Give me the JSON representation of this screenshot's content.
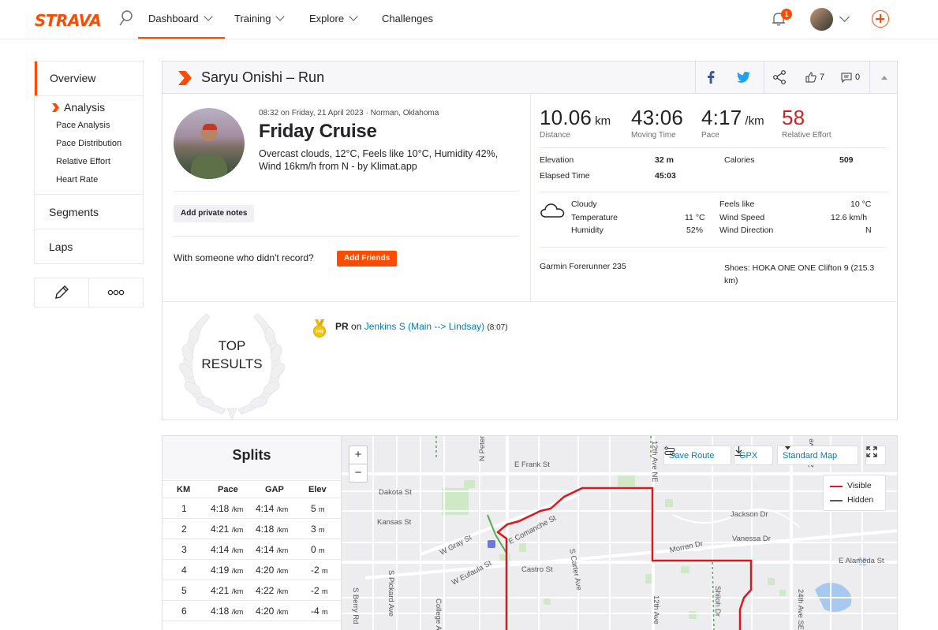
{
  "nav": {
    "logo": "STRAVA",
    "items": [
      {
        "label": "Dashboard"
      },
      {
        "label": "Training"
      },
      {
        "label": "Explore"
      },
      {
        "label": "Challenges"
      }
    ],
    "notif_count": "1",
    "accent": "#fc4c02"
  },
  "sidebar": {
    "overview": "Overview",
    "analysis": "Analysis",
    "subitems": [
      "Pace Analysis",
      "Pace Distribution",
      "Relative Effort",
      "Heart Rate"
    ],
    "segments": "Segments",
    "laps": "Laps"
  },
  "activity": {
    "header_title": "Saryu Onishi – Run",
    "kudos_count": "7",
    "comment_count": "0",
    "meta": "08:32 on Friday, 21 April 2023 · Norman, Oklahoma",
    "title": "Friday Cruise",
    "description": "Overcast clouds, 12°C, Feels like 10°C, Humidity 42%, Wind 16km/h from N - by Klimat.app",
    "add_notes": "Add private notes",
    "with_someone": "With someone who didn't record?",
    "add_friends": "Add Friends"
  },
  "stats": {
    "distance": {
      "value": "10.06",
      "unit": "km",
      "label": "Distance"
    },
    "moving_time": {
      "value": "43:06",
      "label": "Moving Time"
    },
    "pace": {
      "value": "4:17",
      "unit": "/km",
      "label": "Pace"
    },
    "relative_effort": {
      "value": "58",
      "label": "Relative Effort",
      "color": "#d81e1e"
    },
    "elevation_label": "Elevation",
    "elevation": "32 m",
    "calories_label": "Calories",
    "calories": "509",
    "elapsed_label": "Elapsed Time",
    "elapsed": "45:03"
  },
  "weather": {
    "condition": "Cloudy",
    "temperature_label": "Temperature",
    "temperature": "11 °C",
    "humidity_label": "Humidity",
    "humidity": "52%",
    "feels_label": "Feels like",
    "feels": "10 °C",
    "wind_speed_label": "Wind Speed",
    "wind_speed": "12.6 km/h",
    "wind_dir_label": "Wind Direction",
    "wind_dir": "N"
  },
  "gear": {
    "device": "Garmin Forerunner 235",
    "shoes": "Shoes: HOKA ONE ONE Clifton 9 (215.3 km)"
  },
  "results": {
    "top_results": "TOP RESULTS",
    "pr_label": "PR",
    "pr_on": "on",
    "segment": "Jenkins S (Main --> Lindsay)",
    "time": "(8:07)"
  },
  "splits": {
    "title": "Splits",
    "headers": [
      "KM",
      "Pace",
      "GAP",
      "Elev"
    ],
    "pace_unit": "/km",
    "elev_unit": "m",
    "rows": [
      {
        "km": "1",
        "pace": "4:18",
        "gap": "4:14",
        "elev": "5"
      },
      {
        "km": "2",
        "pace": "4:21",
        "gap": "4:18",
        "elev": "3"
      },
      {
        "km": "3",
        "pace": "4:14",
        "gap": "4:14",
        "elev": "0"
      },
      {
        "km": "4",
        "pace": "4:19",
        "gap": "4:20",
        "elev": "-2"
      },
      {
        "km": "5",
        "pace": "4:21",
        "gap": "4:22",
        "elev": "-2"
      },
      {
        "km": "6",
        "pace": "4:18",
        "gap": "4:20",
        "elev": "-4"
      }
    ]
  },
  "map": {
    "zoom_in": "+",
    "zoom_out": "−",
    "save_route": "Save Route",
    "gpx": "GPX",
    "map_type": "Standard Map",
    "legend_visible": "Visible",
    "legend_hidden": "Hidden",
    "streets": [
      "E Frank St",
      "N Peters",
      "Dakota St",
      "Kansas St",
      "W Gray St",
      "E Comanche St",
      "S Carter Ave",
      "W Eufaula St",
      "Castro St",
      "S Pickard Ave",
      "S Berry Rd",
      "College Ave",
      "12th Ave NE",
      "24th Ave NE",
      "Jackson Dr",
      "Vanessa Dr",
      "Morren Dr",
      "E Alameda St",
      "Shiloh Dr",
      "12th Ave",
      "24th Ave SE"
    ],
    "route_color": "#e0161c"
  }
}
